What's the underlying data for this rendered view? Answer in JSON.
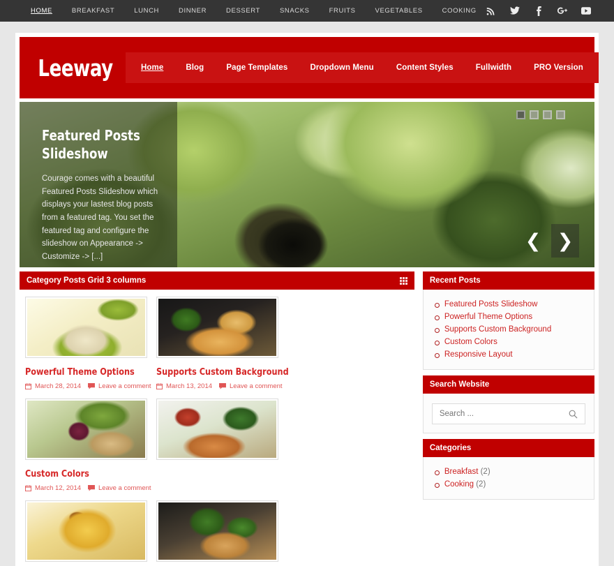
{
  "topbar": {
    "menu": [
      {
        "label": "HOME",
        "active": true
      },
      {
        "label": "BREAKFAST",
        "active": false
      },
      {
        "label": "LUNCH",
        "active": false
      },
      {
        "label": "DINNER",
        "active": false
      },
      {
        "label": "DESSERT",
        "active": false
      },
      {
        "label": "SNACKS",
        "active": false
      },
      {
        "label": "FRUITS",
        "active": false
      },
      {
        "label": "VEGETABLES",
        "active": false
      },
      {
        "label": "COOKING",
        "active": false
      }
    ],
    "social": [
      "rss-icon",
      "twitter-icon",
      "facebook-icon",
      "google-plus-icon",
      "youtube-icon"
    ],
    "background": "#353535"
  },
  "header": {
    "logo": "Leeway",
    "brand_color": "#c00000",
    "nav": [
      {
        "label": "Home",
        "active": true
      },
      {
        "label": "Blog",
        "active": false
      },
      {
        "label": "Page Templates",
        "active": false
      },
      {
        "label": "Dropdown Menu",
        "active": false
      },
      {
        "label": "Content Styles",
        "active": false
      },
      {
        "label": "Fullwidth",
        "active": false
      },
      {
        "label": "PRO Version",
        "active": false
      }
    ]
  },
  "slider": {
    "title": "Featured Posts Slideshow",
    "excerpt": "Courage comes with a beautiful Featured Posts Slideshow which displays your lastest blog posts from a featured tag. You set the featured tag and configure the slideshow on Appearance -> Customize -> [...]",
    "dots": 4,
    "active_dot": 1,
    "prev_icon": "chevron-left-icon",
    "next_icon": "chevron-right-icon",
    "image_alt": "salad-with-cucumber-and-olive"
  },
  "main": {
    "section_title": "Category Posts Grid 3 columns",
    "grid_icon": "grid-view-icon",
    "posts": [
      {
        "title": "Powerful Theme Options",
        "date": "March 28, 2014",
        "comments": "Leave a comment",
        "image": "dumpling-bowl"
      },
      {
        "title": "Supports Custom Background",
        "date": "March 13, 2014",
        "comments": "Leave a comment",
        "image": "pizza-slice"
      },
      {
        "title": "Custom Colors",
        "date": "March 12, 2014",
        "comments": "Leave a comment",
        "image": "vegetables-board"
      },
      {
        "title": "",
        "date": "",
        "comments": "",
        "image": "salmon-salad"
      },
      {
        "title": "",
        "date": "",
        "comments": "",
        "image": "cheese-tart"
      },
      {
        "title": "",
        "date": "",
        "comments": "",
        "image": "burger-basil"
      }
    ],
    "date_icon": "calendar-icon",
    "comment_icon": "comment-bubble-icon"
  },
  "sidebar": {
    "recent_posts": {
      "title": "Recent Posts",
      "items": [
        "Featured Posts Slideshow",
        "Powerful Theme Options",
        "Supports Custom Background",
        "Custom Colors",
        "Responsive Layout"
      ]
    },
    "search": {
      "title": "Search Website",
      "placeholder": "Search ...",
      "value": "",
      "icon": "search-icon"
    },
    "categories": {
      "title": "Categories",
      "items": [
        {
          "label": "Breakfast",
          "count": "(2)"
        },
        {
          "label": "Cooking",
          "count": "(2)"
        }
      ]
    }
  }
}
